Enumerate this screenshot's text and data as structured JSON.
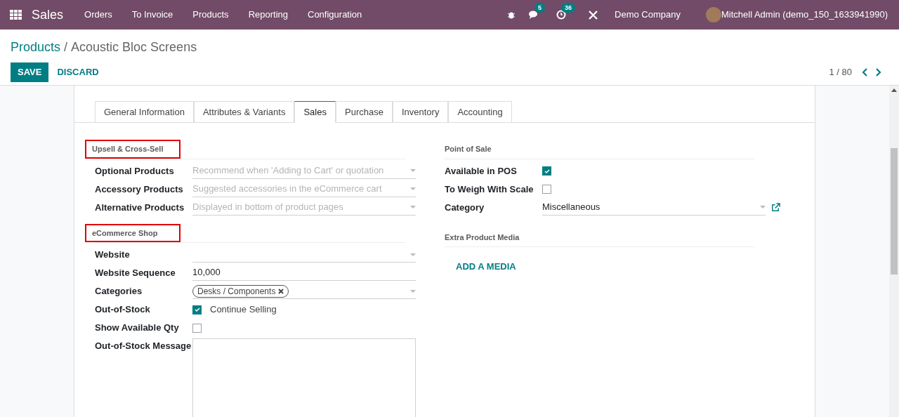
{
  "navbar": {
    "app": "Sales",
    "menu": [
      "Orders",
      "To Invoice",
      "Products",
      "Reporting",
      "Configuration"
    ],
    "messages_count": "5",
    "activities_count": "36",
    "company": "Demo Company",
    "user": "Mitchell Admin (demo_150_1633941990)"
  },
  "breadcrumb": {
    "parent": "Products",
    "separator": "/",
    "current": "Acoustic Bloc Screens"
  },
  "buttons": {
    "save": "SAVE",
    "discard": "DISCARD"
  },
  "pager": "1 / 80",
  "tabs": [
    {
      "label": "General Information",
      "selected": false
    },
    {
      "label": "Attributes & Variants",
      "selected": false
    },
    {
      "label": "Sales",
      "selected": true
    },
    {
      "label": "Purchase",
      "selected": false
    },
    {
      "label": "Inventory",
      "selected": false
    },
    {
      "label": "Accounting",
      "selected": false
    }
  ],
  "left_sections": [
    {
      "title": "Upsell & Cross-Sell",
      "highlighted": true,
      "fields": [
        {
          "kind": "select",
          "label": "Optional Products",
          "placeholder": "Recommend when 'Adding to Cart' or quotation"
        },
        {
          "kind": "select",
          "label": "Accessory Products",
          "placeholder": "Suggested accessories in the eCommerce cart"
        },
        {
          "kind": "select",
          "label": "Alternative Products",
          "placeholder": "Displayed in bottom of product pages"
        }
      ]
    },
    {
      "title": "eCommerce Shop",
      "highlighted": true,
      "fields": [
        {
          "kind": "select",
          "label": "Website"
        },
        {
          "kind": "text",
          "label": "Website Sequence",
          "value": "10,000"
        },
        {
          "kind": "tags",
          "label": "Categories",
          "tags": [
            "Desks / Components"
          ]
        },
        {
          "kind": "checkbox",
          "label": "Out-of-Stock",
          "checked": true,
          "caption": "Continue Selling"
        },
        {
          "kind": "checkbox",
          "label": "Show Available Qty",
          "checked": false
        },
        {
          "kind": "textarea",
          "label": "Out-of-Stock Message"
        }
      ]
    }
  ],
  "right_sections": [
    {
      "title": "Point of Sale",
      "highlighted": false,
      "fields": [
        {
          "kind": "checkbox",
          "label": "Available in POS",
          "checked": true
        },
        {
          "kind": "checkbox",
          "label": "To Weigh With Scale",
          "checked": false
        },
        {
          "kind": "select",
          "label": "Category",
          "value": "Miscellaneous",
          "external": true
        }
      ]
    },
    {
      "title": "Extra Product Media",
      "highlighted": false,
      "action": "ADD A MEDIA"
    }
  ]
}
